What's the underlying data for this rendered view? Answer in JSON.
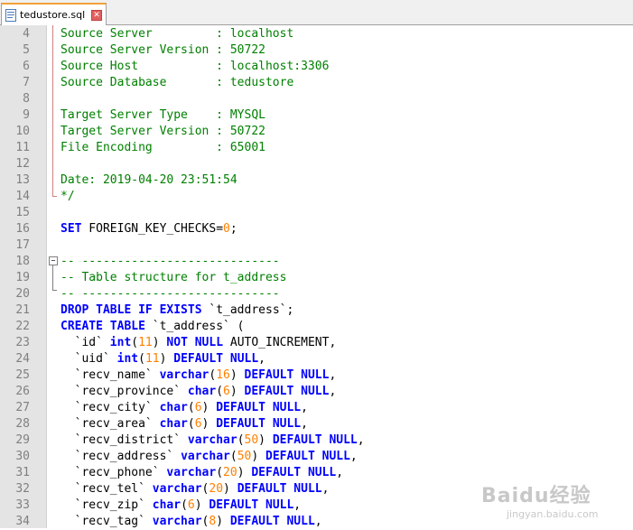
{
  "tab": {
    "label": "tedustore.sql",
    "close_symbol": "✕"
  },
  "lines": [
    {
      "n": "4",
      "segs": [
        {
          "t": "Source Server         : localhost",
          "s": "c"
        }
      ]
    },
    {
      "n": "5",
      "segs": [
        {
          "t": "Source Server Version : 50722",
          "s": "c"
        }
      ]
    },
    {
      "n": "6",
      "segs": [
        {
          "t": "Source Host           : localhost:3306",
          "s": "c"
        }
      ]
    },
    {
      "n": "7",
      "segs": [
        {
          "t": "Source Database       : tedustore",
          "s": "c"
        }
      ]
    },
    {
      "n": "8",
      "segs": []
    },
    {
      "n": "9",
      "segs": [
        {
          "t": "Target Server Type    : MYSQL",
          "s": "c"
        }
      ]
    },
    {
      "n": "10",
      "segs": [
        {
          "t": "Target Server Version : 50722",
          "s": "c"
        }
      ]
    },
    {
      "n": "11",
      "segs": [
        {
          "t": "File Encoding         : 65001",
          "s": "c"
        }
      ]
    },
    {
      "n": "12",
      "segs": []
    },
    {
      "n": "13",
      "segs": [
        {
          "t": "Date: 2019-04-20 23:51:54",
          "s": "c"
        }
      ]
    },
    {
      "n": "14",
      "segs": [
        {
          "t": "*/",
          "s": "c"
        }
      ]
    },
    {
      "n": "15",
      "segs": []
    },
    {
      "n": "16",
      "segs": [
        {
          "t": "SET",
          "s": "k"
        },
        {
          "t": " FOREIGN_KEY_CHECKS=",
          "s": "p"
        },
        {
          "t": "0",
          "s": "n"
        },
        {
          "t": ";",
          "s": "p"
        }
      ]
    },
    {
      "n": "17",
      "segs": []
    },
    {
      "n": "18",
      "segs": [
        {
          "t": "-- ----------------------------",
          "s": "c"
        }
      ]
    },
    {
      "n": "19",
      "segs": [
        {
          "t": "-- Table structure for t_address",
          "s": "c"
        }
      ]
    },
    {
      "n": "20",
      "segs": [
        {
          "t": "-- ----------------------------",
          "s": "c"
        }
      ]
    },
    {
      "n": "21",
      "segs": [
        {
          "t": "DROP TABLE IF EXISTS",
          "s": "k"
        },
        {
          "t": " `t_address`;",
          "s": "p"
        }
      ]
    },
    {
      "n": "22",
      "segs": [
        {
          "t": "CREATE TABLE",
          "s": "k"
        },
        {
          "t": " `t_address` (",
          "s": "p"
        }
      ]
    },
    {
      "n": "23",
      "segs": [
        {
          "t": "  `id` ",
          "s": "p"
        },
        {
          "t": "int",
          "s": "k"
        },
        {
          "t": "(",
          "s": "p"
        },
        {
          "t": "11",
          "s": "n"
        },
        {
          "t": ") ",
          "s": "p"
        },
        {
          "t": "NOT NULL",
          "s": "k"
        },
        {
          "t": " AUTO_INCREMENT,",
          "s": "p"
        }
      ]
    },
    {
      "n": "24",
      "segs": [
        {
          "t": "  `uid` ",
          "s": "p"
        },
        {
          "t": "int",
          "s": "k"
        },
        {
          "t": "(",
          "s": "p"
        },
        {
          "t": "11",
          "s": "n"
        },
        {
          "t": ") ",
          "s": "p"
        },
        {
          "t": "DEFAULT NULL",
          "s": "k"
        },
        {
          "t": ",",
          "s": "p"
        }
      ]
    },
    {
      "n": "25",
      "segs": [
        {
          "t": "  `recv_name` ",
          "s": "p"
        },
        {
          "t": "varchar",
          "s": "k"
        },
        {
          "t": "(",
          "s": "p"
        },
        {
          "t": "16",
          "s": "n"
        },
        {
          "t": ") ",
          "s": "p"
        },
        {
          "t": "DEFAULT NULL",
          "s": "k"
        },
        {
          "t": ",",
          "s": "p"
        }
      ]
    },
    {
      "n": "26",
      "segs": [
        {
          "t": "  `recv_province` ",
          "s": "p"
        },
        {
          "t": "char",
          "s": "k"
        },
        {
          "t": "(",
          "s": "p"
        },
        {
          "t": "6",
          "s": "n"
        },
        {
          "t": ") ",
          "s": "p"
        },
        {
          "t": "DEFAULT NULL",
          "s": "k"
        },
        {
          "t": ",",
          "s": "p"
        }
      ]
    },
    {
      "n": "27",
      "segs": [
        {
          "t": "  `recv_city` ",
          "s": "p"
        },
        {
          "t": "char",
          "s": "k"
        },
        {
          "t": "(",
          "s": "p"
        },
        {
          "t": "6",
          "s": "n"
        },
        {
          "t": ") ",
          "s": "p"
        },
        {
          "t": "DEFAULT NULL",
          "s": "k"
        },
        {
          "t": ",",
          "s": "p"
        }
      ]
    },
    {
      "n": "28",
      "segs": [
        {
          "t": "  `recv_area` ",
          "s": "p"
        },
        {
          "t": "char",
          "s": "k"
        },
        {
          "t": "(",
          "s": "p"
        },
        {
          "t": "6",
          "s": "n"
        },
        {
          "t": ") ",
          "s": "p"
        },
        {
          "t": "DEFAULT NULL",
          "s": "k"
        },
        {
          "t": ",",
          "s": "p"
        }
      ]
    },
    {
      "n": "29",
      "segs": [
        {
          "t": "  `recv_district` ",
          "s": "p"
        },
        {
          "t": "varchar",
          "s": "k"
        },
        {
          "t": "(",
          "s": "p"
        },
        {
          "t": "50",
          "s": "n"
        },
        {
          "t": ") ",
          "s": "p"
        },
        {
          "t": "DEFAULT NULL",
          "s": "k"
        },
        {
          "t": ",",
          "s": "p"
        }
      ]
    },
    {
      "n": "30",
      "segs": [
        {
          "t": "  `recv_address` ",
          "s": "p"
        },
        {
          "t": "varchar",
          "s": "k"
        },
        {
          "t": "(",
          "s": "p"
        },
        {
          "t": "50",
          "s": "n"
        },
        {
          "t": ") ",
          "s": "p"
        },
        {
          "t": "DEFAULT NULL",
          "s": "k"
        },
        {
          "t": ",",
          "s": "p"
        }
      ]
    },
    {
      "n": "31",
      "segs": [
        {
          "t": "  `recv_phone` ",
          "s": "p"
        },
        {
          "t": "varchar",
          "s": "k"
        },
        {
          "t": "(",
          "s": "p"
        },
        {
          "t": "20",
          "s": "n"
        },
        {
          "t": ") ",
          "s": "p"
        },
        {
          "t": "DEFAULT NULL",
          "s": "k"
        },
        {
          "t": ",",
          "s": "p"
        }
      ]
    },
    {
      "n": "32",
      "segs": [
        {
          "t": "  `recv_tel` ",
          "s": "p"
        },
        {
          "t": "varchar",
          "s": "k"
        },
        {
          "t": "(",
          "s": "p"
        },
        {
          "t": "20",
          "s": "n"
        },
        {
          "t": ") ",
          "s": "p"
        },
        {
          "t": "DEFAULT NULL",
          "s": "k"
        },
        {
          "t": ",",
          "s": "p"
        }
      ]
    },
    {
      "n": "33",
      "segs": [
        {
          "t": "  `recv_zip` ",
          "s": "p"
        },
        {
          "t": "char",
          "s": "k"
        },
        {
          "t": "(",
          "s": "p"
        },
        {
          "t": "6",
          "s": "n"
        },
        {
          "t": ") ",
          "s": "p"
        },
        {
          "t": "DEFAULT NULL",
          "s": "k"
        },
        {
          "t": ",",
          "s": "p"
        }
      ]
    },
    {
      "n": "34",
      "segs": [
        {
          "t": "  `recv_tag` ",
          "s": "p"
        },
        {
          "t": "varchar",
          "s": "k"
        },
        {
          "t": "(",
          "s": "p"
        },
        {
          "t": "8",
          "s": "n"
        },
        {
          "t": ") ",
          "s": "p"
        },
        {
          "t": "DEFAULT NULL",
          "s": "k"
        },
        {
          "t": ",",
          "s": "p"
        }
      ]
    }
  ],
  "watermark": {
    "main": "Baidu经验",
    "sub": "jingyan.baidu.com"
  },
  "colors": {
    "comment": "#008000",
    "keyword": "#0000ff",
    "number": "#ff8000",
    "tab_accent": "#f2a03a"
  }
}
